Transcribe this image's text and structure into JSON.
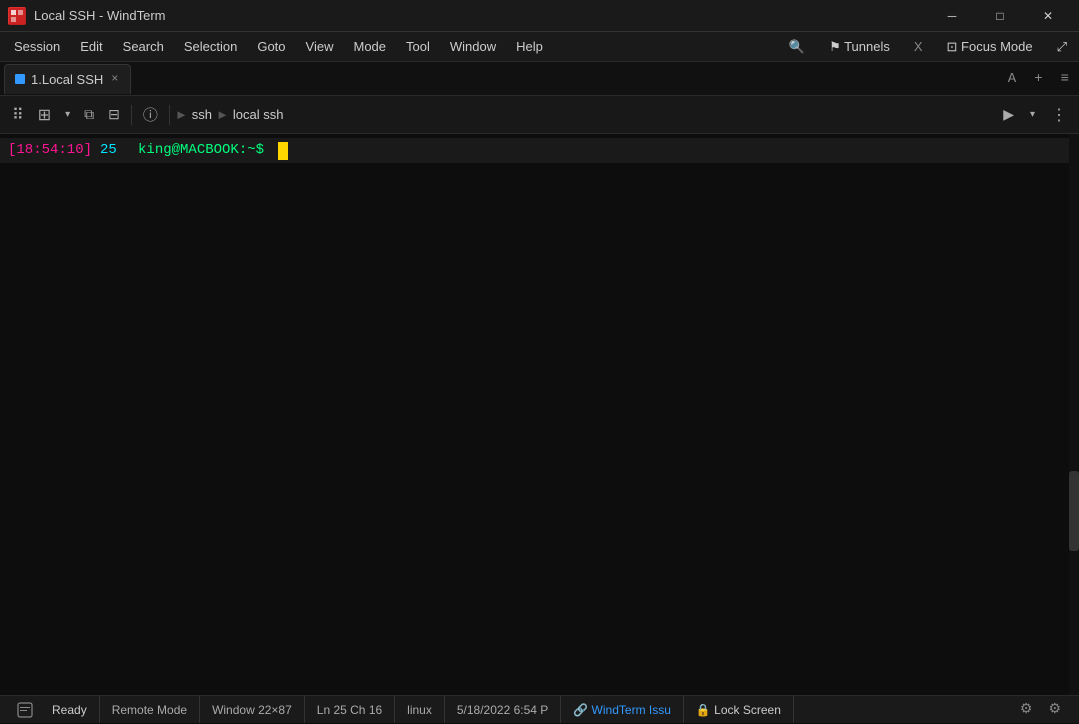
{
  "window": {
    "title": "Local SSH - WindTerm",
    "icon_label": "W"
  },
  "titlebar": {
    "minimize_label": "─",
    "maximize_label": "□",
    "close_label": "✕"
  },
  "menubar": {
    "items": [
      {
        "label": "Session"
      },
      {
        "label": "Edit"
      },
      {
        "label": "Search"
      },
      {
        "label": "Selection"
      },
      {
        "label": "Goto"
      },
      {
        "label": "View"
      },
      {
        "label": "Mode"
      },
      {
        "label": "Tool"
      },
      {
        "label": "Window"
      },
      {
        "label": "Help"
      }
    ],
    "right_items": [
      {
        "label": "🔍",
        "name": "search-icon"
      },
      {
        "label": "⚑ Tunnels",
        "name": "tunnels-btn"
      },
      {
        "label": "X",
        "name": "x-btn"
      },
      {
        "label": "⊡ Focus Mode",
        "name": "focus-mode-btn"
      },
      {
        "label": "⤢",
        "name": "expand-btn"
      }
    ]
  },
  "tabbar": {
    "tabs": [
      {
        "label": "1.Local SSH",
        "active": true
      }
    ],
    "right_buttons": [
      {
        "label": "A",
        "name": "font-btn"
      },
      {
        "label": "+",
        "name": "new-tab-btn"
      },
      {
        "label": "≡",
        "name": "menu-btn"
      }
    ]
  },
  "toolbar": {
    "left_buttons": [
      {
        "label": "⠿",
        "name": "drag-handle"
      },
      {
        "label": "⊞",
        "name": "new-session-btn"
      },
      {
        "label": "▾",
        "name": "session-dropdown"
      },
      {
        "label": "⧉",
        "name": "split-h-btn"
      },
      {
        "label": "⊟",
        "name": "split-v-btn"
      },
      {
        "label": "ⓘ",
        "name": "info-btn"
      }
    ],
    "breadcrumb": [
      {
        "label": "ssh",
        "name": "breadcrumb-ssh"
      },
      {
        "label": "►",
        "name": "breadcrumb-arrow-1"
      },
      {
        "label": "local ssh",
        "name": "breadcrumb-local-ssh"
      }
    ],
    "right_buttons": [
      {
        "label": "▶",
        "name": "run-btn"
      },
      {
        "label": "▾",
        "name": "run-dropdown"
      },
      {
        "label": "⋮",
        "name": "more-btn"
      }
    ]
  },
  "terminal": {
    "prompt_time": "[18:54:10]",
    "prompt_num": "25",
    "prompt_user": "king@MACBOOK:~$",
    "command": ""
  },
  "statusbar": {
    "ready": "Ready",
    "remote_mode": "Remote Mode",
    "window_size": "Window 22×87",
    "cursor_pos": "Ln 25 Ch 16",
    "os": "linux",
    "datetime": "5/18/2022 6:54 P",
    "windterm_issue": "🔗 WindTerm Issu",
    "lock_screen": "🔒 Lock Screen",
    "gear_icon": "⚙",
    "settings_icon": "⚙"
  },
  "colors": {
    "background": "#0d0d0d",
    "prompt_time": "#ff1493",
    "prompt_num": "#00e5ff",
    "prompt_user": "#00ff7f",
    "cursor": "#ffd700",
    "accent_blue": "#3399ff"
  }
}
